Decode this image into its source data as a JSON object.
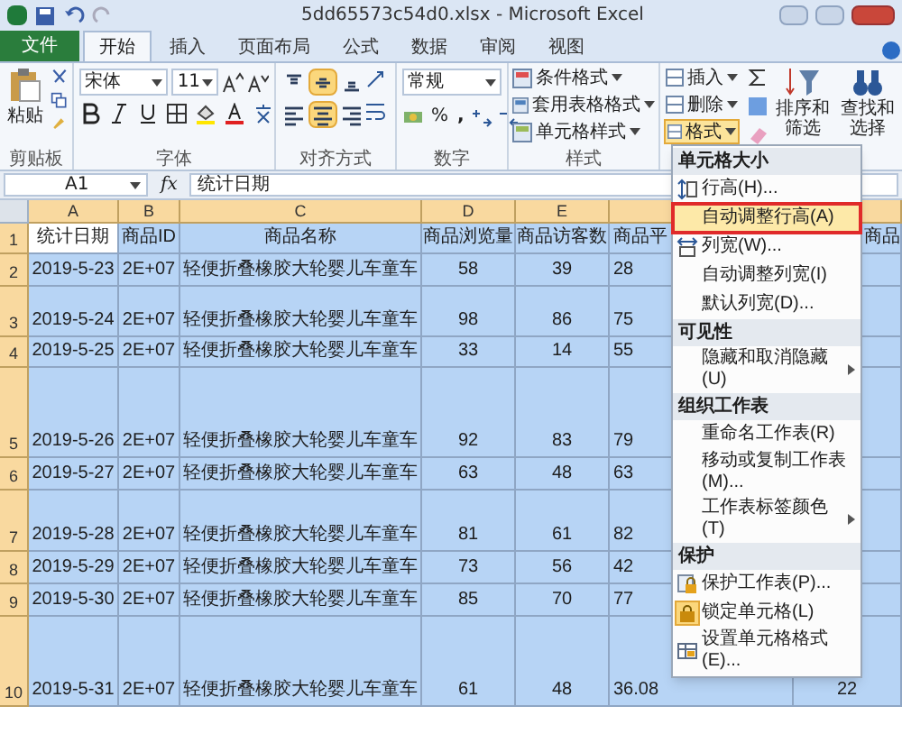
{
  "window": {
    "title": "5dd65573c54d0.xlsx - Microsoft Excel"
  },
  "ribbon_tabs": [
    {
      "label": "文件",
      "kind": "file",
      "selected": false
    },
    {
      "label": "开始",
      "kind": "tab",
      "selected": true
    },
    {
      "label": "插入",
      "kind": "tab",
      "selected": false
    },
    {
      "label": "页面布局",
      "kind": "tab",
      "selected": false
    },
    {
      "label": "公式",
      "kind": "tab",
      "selected": false
    },
    {
      "label": "数据",
      "kind": "tab",
      "selected": false
    },
    {
      "label": "审阅",
      "kind": "tab",
      "selected": false
    },
    {
      "label": "视图",
      "kind": "tab",
      "selected": false
    }
  ],
  "clipboard": {
    "paste": "粘贴",
    "label": "剪贴板"
  },
  "font": {
    "name": "宋体",
    "size": "11",
    "label": "字体"
  },
  "alignment": {
    "label": "对齐方式",
    "buttons": [
      {
        "kind": "top",
        "on": false
      },
      {
        "kind": "middle",
        "on": true
      },
      {
        "kind": "bottom",
        "on": false
      },
      {
        "kind": "left",
        "on": false
      },
      {
        "kind": "center",
        "on": true
      },
      {
        "kind": "right",
        "on": false
      }
    ]
  },
  "number": {
    "format": "常规",
    "percent": "%",
    "comma": ",",
    "label": "数字"
  },
  "styles": {
    "items": [
      "条件格式",
      "套用表格格式",
      "单元格样式"
    ],
    "label": "样式"
  },
  "cells": {
    "items": [
      {
        "label": "插入",
        "selected": false
      },
      {
        "label": "删除",
        "selected": false
      },
      {
        "label": "格式",
        "selected": true
      }
    ]
  },
  "editing": {
    "sort": "排序和筛选",
    "find": "查找和选择"
  },
  "formula_bar": {
    "name_box": "A1",
    "function": "fx",
    "value": "统计日期"
  },
  "sheet": {
    "columns": [
      "A",
      "B",
      "C",
      "D",
      "E"
    ],
    "rows": [
      {
        "number": "1",
        "cells": [
          {
            "text": "统计日期",
            "selected": false
          },
          {
            "text": "商品ID",
            "selected": true
          },
          {
            "text": "商品名称",
            "selected": true
          },
          {
            "text": "商品浏览量",
            "selected": true
          },
          {
            "text": "商品访客数",
            "selected": true
          },
          {
            "text": "商品平",
            "selected": true
          },
          {
            "text": "商品",
            "selected": true
          }
        ]
      },
      {
        "number": "2",
        "cells": [
          {
            "text": "2019-5-23",
            "selected": true
          },
          {
            "text": "2E+07",
            "selected": true
          },
          {
            "text": "轻便折叠橡胶大轮婴儿车童车",
            "selected": true
          },
          {
            "text": "58",
            "selected": true
          },
          {
            "text": "39",
            "selected": true
          },
          {
            "text": "28",
            "selected": true
          }
        ]
      },
      {
        "number": "3",
        "cells": [
          {
            "text": "2019-5-24",
            "selected": true
          },
          {
            "text": "2E+07",
            "selected": true
          },
          {
            "text": "轻便折叠橡胶大轮婴儿车童车",
            "selected": true
          },
          {
            "text": "98",
            "selected": true
          },
          {
            "text": "86",
            "selected": true
          },
          {
            "text": "75",
            "selected": true
          }
        ]
      },
      {
        "number": "4",
        "cells": [
          {
            "text": "2019-5-25",
            "selected": true
          },
          {
            "text": "2E+07",
            "selected": true
          },
          {
            "text": "轻便折叠橡胶大轮婴儿车童车",
            "selected": true
          },
          {
            "text": "33",
            "selected": true
          },
          {
            "text": "14",
            "selected": true
          },
          {
            "text": "55",
            "selected": true
          }
        ]
      },
      {
        "number": "5",
        "cells": [
          {
            "text": "2019-5-26",
            "selected": true
          },
          {
            "text": "2E+07",
            "selected": true
          },
          {
            "text": "轻便折叠橡胶大轮婴儿车童车",
            "selected": true
          },
          {
            "text": "92",
            "selected": true
          },
          {
            "text": "83",
            "selected": true
          },
          {
            "text": "79",
            "selected": true
          }
        ]
      },
      {
        "number": "6",
        "cells": [
          {
            "text": "2019-5-27",
            "selected": true
          },
          {
            "text": "2E+07",
            "selected": true
          },
          {
            "text": "轻便折叠橡胶大轮婴儿车童车",
            "selected": true
          },
          {
            "text": "63",
            "selected": true
          },
          {
            "text": "48",
            "selected": true
          },
          {
            "text": "63",
            "selected": true
          }
        ]
      },
      {
        "number": "7",
        "cells": [
          {
            "text": "2019-5-28",
            "selected": true
          },
          {
            "text": "2E+07",
            "selected": true
          },
          {
            "text": "轻便折叠橡胶大轮婴儿车童车",
            "selected": true
          },
          {
            "text": "81",
            "selected": true
          },
          {
            "text": "61",
            "selected": true
          },
          {
            "text": "82",
            "selected": true
          }
        ]
      },
      {
        "number": "8",
        "cells": [
          {
            "text": "2019-5-29",
            "selected": true
          },
          {
            "text": "2E+07",
            "selected": true
          },
          {
            "text": "轻便折叠橡胶大轮婴儿车童车",
            "selected": true
          },
          {
            "text": "73",
            "selected": true
          },
          {
            "text": "56",
            "selected": true
          },
          {
            "text": "42",
            "selected": true
          }
        ]
      },
      {
        "number": "9",
        "cells": [
          {
            "text": "2019-5-30",
            "selected": true
          },
          {
            "text": "2E+07",
            "selected": true
          },
          {
            "text": "轻便折叠橡胶大轮婴儿车童车",
            "selected": true
          },
          {
            "text": "85",
            "selected": true
          },
          {
            "text": "70",
            "selected": true
          },
          {
            "text": "77",
            "selected": true
          }
        ]
      },
      {
        "number": "10",
        "cells": [
          {
            "text": "2019-5-31",
            "selected": true
          },
          {
            "text": "2E+07",
            "selected": true
          },
          {
            "text": "轻便折叠橡胶大轮婴儿车童车",
            "selected": true
          },
          {
            "text": "61",
            "selected": true
          },
          {
            "text": "48",
            "selected": true
          },
          {
            "text": "36.08",
            "selected": true
          },
          {
            "text": "22",
            "selected": true
          }
        ]
      }
    ]
  },
  "menu": {
    "entries": [
      {
        "kind": "header",
        "label": "单元格大小"
      },
      {
        "kind": "rowheight",
        "label": "行高(H)...",
        "selected": false
      },
      {
        "kind": "plain",
        "label": "自动调整行高(A)",
        "selected": true
      },
      {
        "kind": "colwidth",
        "label": "列宽(W)...",
        "selected": false
      },
      {
        "kind": "plain",
        "label": "自动调整列宽(I)",
        "selected": false
      },
      {
        "kind": "plain",
        "label": "默认列宽(D)...",
        "selected": false
      },
      {
        "kind": "header",
        "label": "可见性"
      },
      {
        "kind": "submenu",
        "label": "隐藏和取消隐藏(U)",
        "selected": false
      },
      {
        "kind": "header",
        "label": "组织工作表"
      },
      {
        "kind": "plain",
        "label": "重命名工作表(R)",
        "selected": false
      },
      {
        "kind": "plain",
        "label": "移动或复制工作表(M)...",
        "selected": false
      },
      {
        "kind": "submenu",
        "label": "工作表标签颜色(T)",
        "selected": false
      },
      {
        "kind": "header",
        "label": "保护"
      },
      {
        "kind": "protect",
        "label": "保护工作表(P)...",
        "selected": false
      },
      {
        "kind": "lock",
        "label": "锁定单元格(L)",
        "selected": false
      },
      {
        "kind": "format",
        "label": "设置单元格格式(E)...",
        "selected": false
      }
    ]
  }
}
